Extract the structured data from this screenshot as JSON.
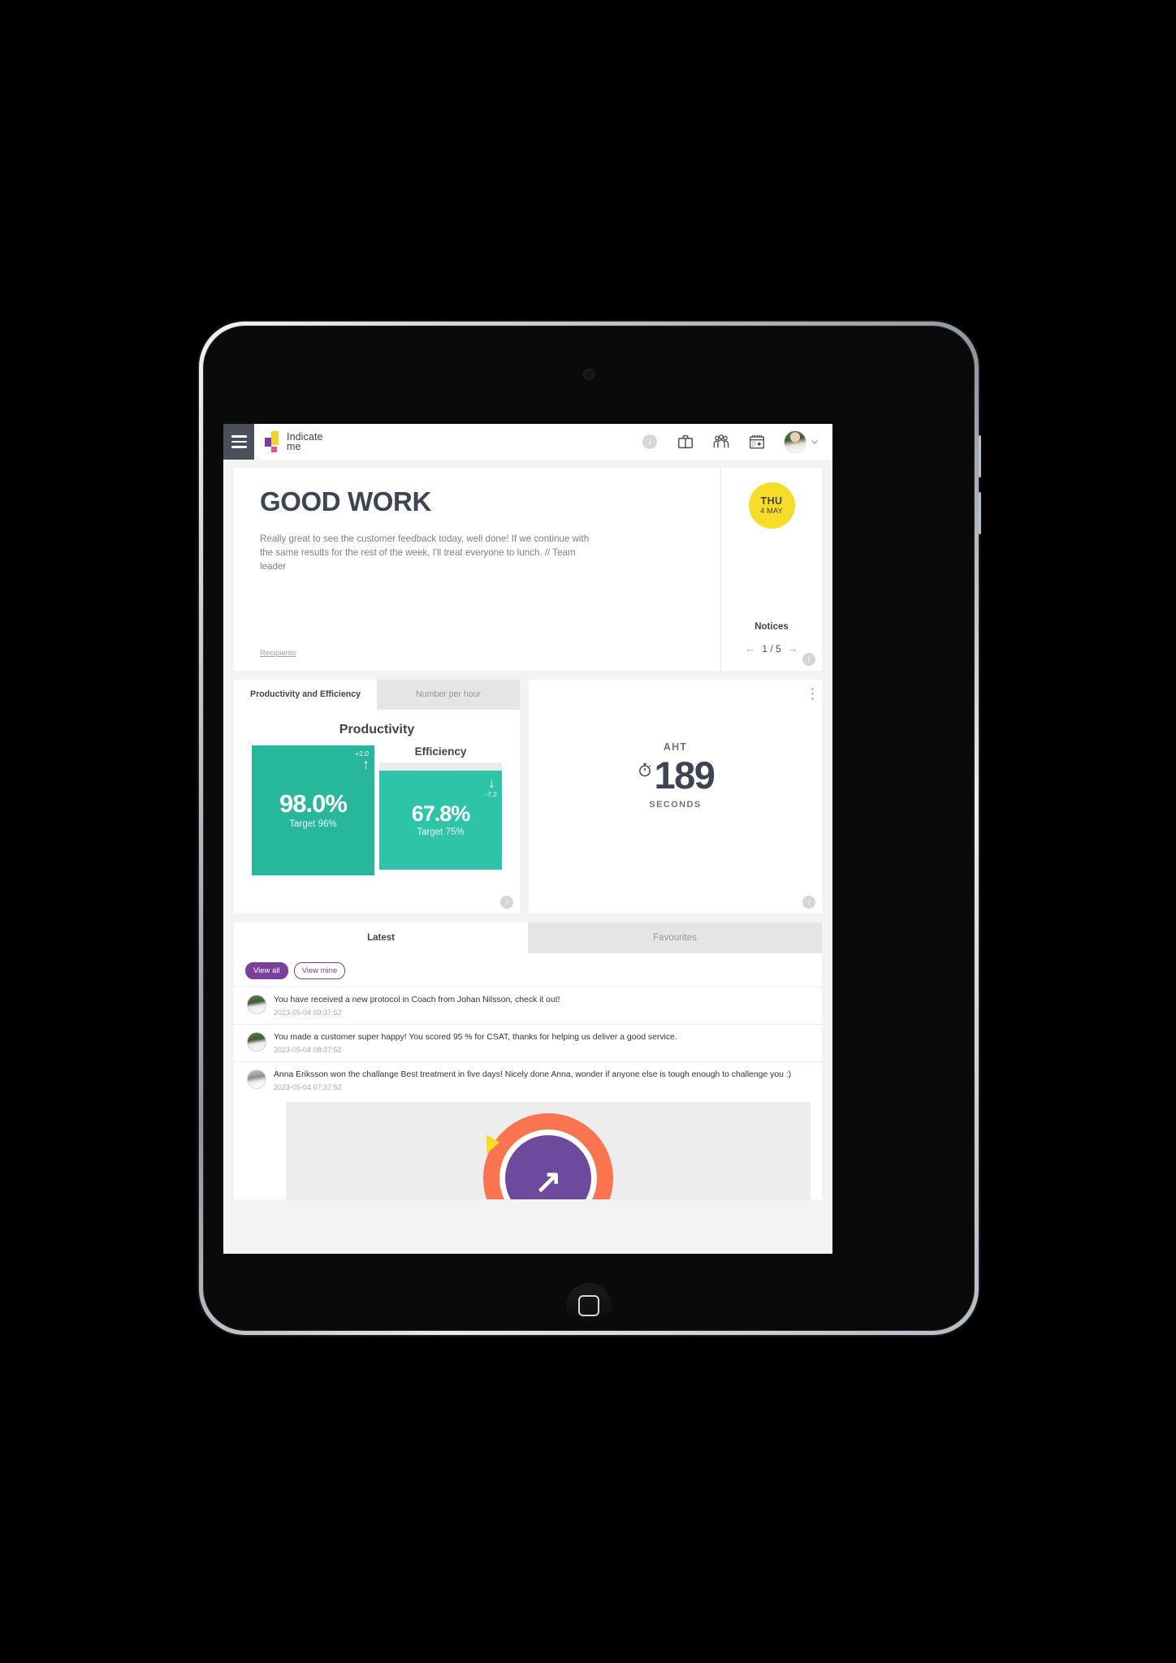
{
  "app": {
    "logo": {
      "line1": "Indicate",
      "line2": "me"
    },
    "topbar_icons": [
      {
        "name": "info-icon",
        "glyph": "i"
      },
      {
        "name": "briefcase-icon"
      },
      {
        "name": "people-group-icon"
      },
      {
        "name": "calendar-icon"
      }
    ],
    "menu_button": "menu-icon",
    "account_chevron": "chevron-down-icon"
  },
  "notice": {
    "title": "GOOD WORK",
    "body": "Really great to see the customer feedback today, well done! If we continue with the same results for the rest of the week, I'll treat everyone to lunch. // Team leader",
    "recipients_link": "Recipients",
    "day_badge": {
      "weekday": "THU",
      "date": "4 MAY"
    },
    "panel_label": "Notices",
    "pagination": {
      "prev": "←",
      "current": "1 / 5",
      "next": "→"
    },
    "info_badge": "i"
  },
  "kpi": {
    "tabs": [
      {
        "label": "Productivity and Efficiency",
        "active": true
      },
      {
        "label": "Number per hour",
        "active": false
      }
    ],
    "productivity": {
      "title": "Productivity",
      "value": "98.0%",
      "target": "Target 96%",
      "delta": "+2,0",
      "trend": "up",
      "color": "#27b79a"
    },
    "efficiency": {
      "title": "Efficiency",
      "value": "67.8%",
      "target": "Target 75%",
      "delta": "-7,2",
      "trend": "down",
      "color": "#2ec4a8"
    },
    "info_badge": "i",
    "aht": {
      "label": "AHT",
      "value": "189",
      "unit": "SECONDS",
      "icon": "stopwatch-icon",
      "menu": "kebab-menu-icon",
      "info_badge": "i"
    }
  },
  "feed": {
    "tabs": [
      {
        "label": "Latest",
        "active": true
      },
      {
        "label": "Favourites",
        "active": false
      }
    ],
    "filters": [
      {
        "label": "View all",
        "active": true
      },
      {
        "label": "View mine",
        "active": false
      }
    ],
    "items": [
      {
        "message": "You have received a new protocol in Coach from Johan Nilsson, check it out!",
        "timestamp": "2023-05-04 09:37:52"
      },
      {
        "message": "You made a customer super happy! You scored 95 % for CSAT, thanks for helping us deliver a good service.",
        "timestamp": "2023-05-04 08:37:52"
      },
      {
        "message": "Anna Eriksson won the challange Best treatment in five days! Nicely done Anna, wonder if anyone else is tough enough to challenge you :)",
        "timestamp": "2023-05-04 07:37:52"
      }
    ]
  },
  "device": {
    "home_button": "home-button"
  }
}
